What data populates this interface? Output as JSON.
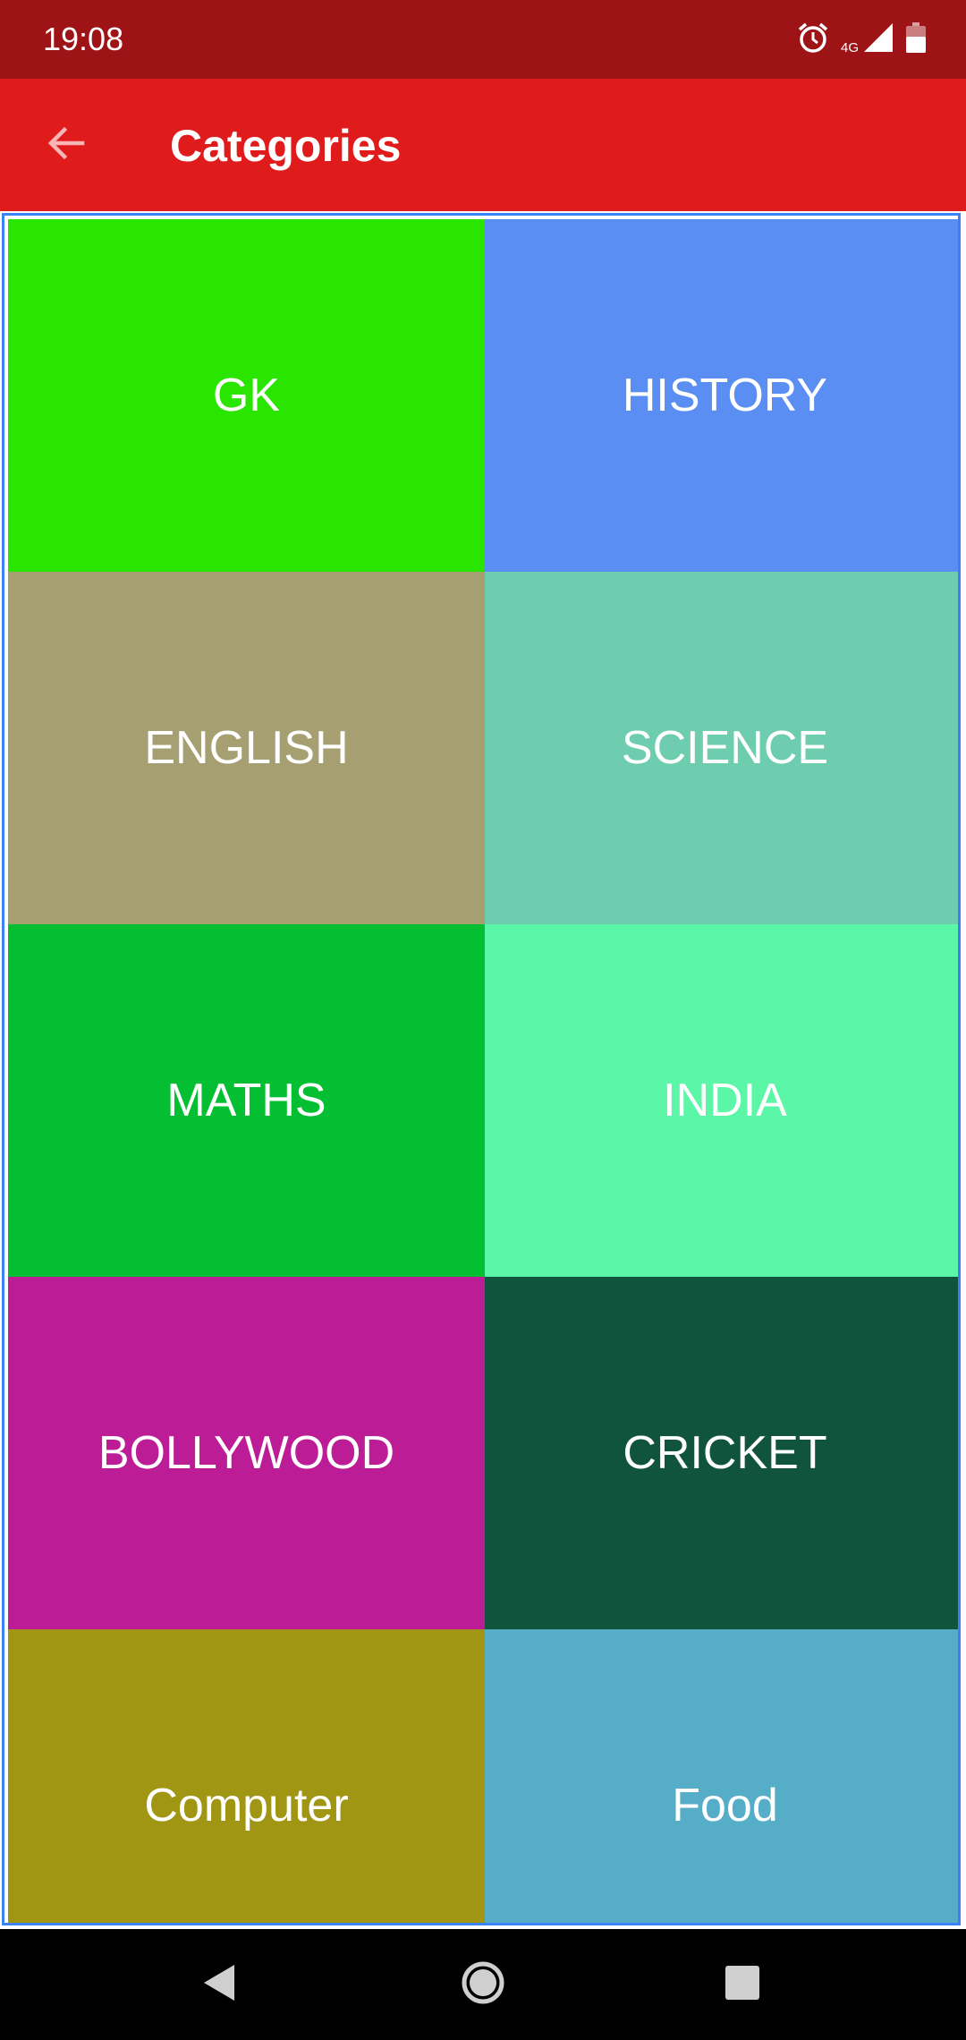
{
  "status_bar": {
    "time": "19:08",
    "network_label": "4G",
    "icons": [
      "alarm-icon",
      "signal-icon",
      "battery-icon"
    ]
  },
  "app_bar": {
    "title": "Categories",
    "back_icon": "arrow-back-icon",
    "background": "#e01b1c"
  },
  "categories": [
    {
      "label": "GK",
      "color": "#29e500"
    },
    {
      "label": "HISTORY",
      "color": "#5b8ef3"
    },
    {
      "label": "ENGLISH",
      "color": "#a59f71"
    },
    {
      "label": "SCIENCE",
      "color": "#6ecdaf"
    },
    {
      "label": "MATHS",
      "color": "#05bf33"
    },
    {
      "label": "INDIA",
      "color": "#5cf6a8"
    },
    {
      "label": "BOLLYWOOD",
      "color": "#bc1c96"
    },
    {
      "label": "CRICKET",
      "color": "#11543e"
    },
    {
      "label": "Computer",
      "color": "#a19514"
    },
    {
      "label": "Food",
      "color": "#56adc7"
    }
  ],
  "nav_bar": {
    "back_icon": "nav-back-icon",
    "home_icon": "nav-home-icon",
    "recents_icon": "nav-recents-icon"
  }
}
